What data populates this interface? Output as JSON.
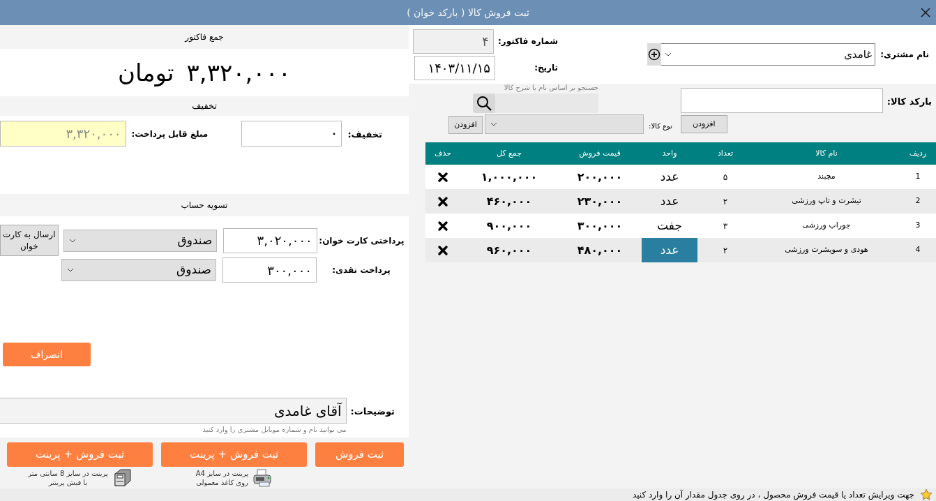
{
  "window": {
    "title": "ثبت فروش کالا ( بارکد خوان )"
  },
  "customer": {
    "label": "نام مشتری:",
    "value": "غامدی"
  },
  "invoice_number": {
    "label": "شماره فاکتور:",
    "value": "۴"
  },
  "date": {
    "label": "تاریخ:",
    "value": "۱۴۰۳/۱۱/۱۵"
  },
  "barcode": {
    "label": "بارکد کالا:",
    "add_button": "افزودن"
  },
  "search": {
    "hint": "جستجو بر اساس نام یا شرح کالا"
  },
  "product_type": {
    "label": "نوع کالا:",
    "add_button": "افزودن"
  },
  "table": {
    "columns": [
      "ردیف",
      "نام کالا",
      "تعداد",
      "واحد",
      "قیمت فروش",
      "جمع کل",
      "حذف"
    ],
    "rows": [
      {
        "index": "1",
        "name": "مچبند",
        "qty": "۵",
        "unit": "عدد",
        "price": "۲۰۰,۰۰۰",
        "total": "۱,۰۰۰,۰۰۰",
        "selected": false
      },
      {
        "index": "2",
        "name": "تیشرت و تاپ ورزشی",
        "qty": "۲",
        "unit": "عدد",
        "price": "۲۳۰,۰۰۰",
        "total": "۴۶۰,۰۰۰",
        "selected": false
      },
      {
        "index": "3",
        "name": "جوراب ورزشی",
        "qty": "۳",
        "unit": "جفت",
        "price": "۳۰۰,۰۰۰",
        "total": "۹۰۰,۰۰۰",
        "selected": false
      },
      {
        "index": "4",
        "name": "هودی و سویشرت ورزشی",
        "qty": "۲",
        "unit": "عدد",
        "price": "۴۸۰,۰۰۰",
        "total": "۹۶۰,۰۰۰",
        "selected": true
      }
    ]
  },
  "invoice_total": {
    "heading": "جمع فاکتور",
    "amount": "۳,۳۲۰,۰۰۰",
    "currency": "تومان"
  },
  "discount": {
    "heading": "تخفیف",
    "label": "تخفیف:",
    "value": "۰",
    "payable_label": "مبلغ قابل پرداخت:",
    "payable_value": "۳,۳۲۰,۰۰۰"
  },
  "settlement": {
    "heading": "تسویه حساب",
    "card": {
      "label": "پرداختی کارت خوان:",
      "value": "۳,۰۲۰,۰۰۰",
      "account": "صندوق",
      "send_button": "ارسال به کارت خوان"
    },
    "cash": {
      "label": "پرداخت نقدی:",
      "value": "۳۰۰,۰۰۰",
      "account": "صندوق"
    }
  },
  "cancel_button": "انصراف",
  "notes": {
    "label": "توضیحات:",
    "value": "آقای غامدی",
    "hint": "می توانید نام و شماره موبایل مشتری را وارد کنید"
  },
  "actions": [
    {
      "label": "ثبت فروش",
      "kind": "plain"
    },
    {
      "label": "ثبت فروش + پرینت",
      "kind": "a4",
      "note": "پرینت در سایز A4\nروی کاغذ معمولی"
    },
    {
      "label": "ثبت فروش + پرینت",
      "kind": "receipt",
      "note": "پرینت در سایز 8 سانتی متر\nبا فیش پرینتر"
    }
  ],
  "status_bar": "جهت ویرایش تعداد یا قیمت فروش محصول ، در روی جدول مقدار آن را وارد کنید"
}
